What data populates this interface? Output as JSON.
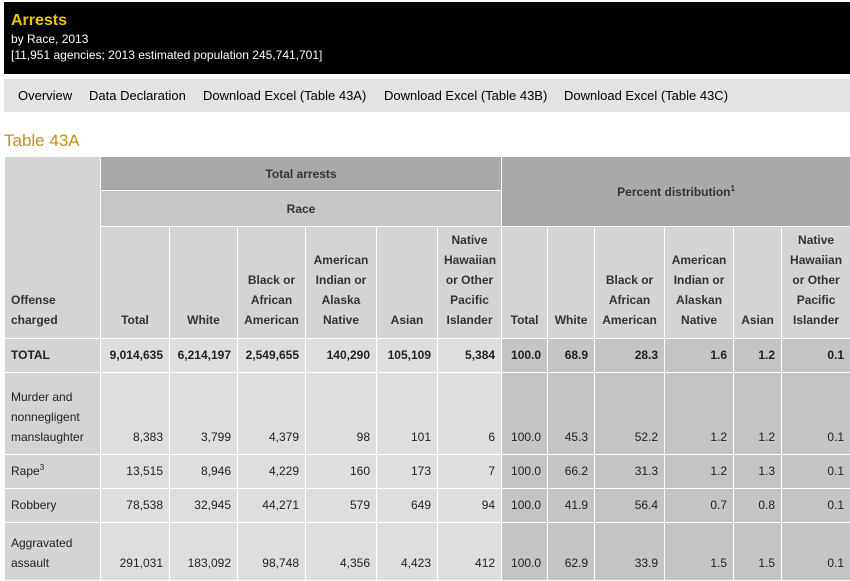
{
  "header": {
    "title": "Arrests",
    "subtitle": "by Race, 2013",
    "scope": "[11,951 agencies; 2013 estimated population 245,741,701]"
  },
  "nav": [
    {
      "label": "Overview"
    },
    {
      "label": "Data Declaration"
    },
    {
      "label": "Download Excel (Table 43A)"
    },
    {
      "label": "Download Excel (Table 43B)"
    },
    {
      "label": "Download Excel (Table 43C)"
    }
  ],
  "table_title": "Table 43A",
  "table": {
    "group_total": "Total arrests",
    "group_race": "Race",
    "group_percent": "Percent distribution",
    "group_percent_note": "1",
    "offense_header": "Offense charged",
    "count_columns": [
      "Total",
      "White",
      "Black or African American",
      "American Indian or Alaska Native",
      "Asian",
      "Native Hawaiian or Other Pacific Islander"
    ],
    "percent_columns": [
      "Total",
      "White",
      "Black or African American",
      "American Indian or Alaskan Native",
      "Asian",
      "Native Hawaiian or Other Pacific Islander"
    ],
    "rows": [
      {
        "offense": "TOTAL",
        "note": "",
        "counts": [
          "9,014,635",
          "6,214,197",
          "2,549,655",
          "140,290",
          "105,109",
          "5,384"
        ],
        "percents": [
          "100.0",
          "68.9",
          "28.3",
          "1.6",
          "1.2",
          "0.1"
        ]
      },
      {
        "offense": "Murder and nonnegligent manslaughter",
        "note": "",
        "counts": [
          "8,383",
          "3,799",
          "4,379",
          "98",
          "101",
          "6"
        ],
        "percents": [
          "100.0",
          "45.3",
          "52.2",
          "1.2",
          "1.2",
          "0.1"
        ]
      },
      {
        "offense": "Rape",
        "note": "3",
        "counts": [
          "13,515",
          "8,946",
          "4,229",
          "160",
          "173",
          "7"
        ],
        "percents": [
          "100.0",
          "66.2",
          "31.3",
          "1.2",
          "1.3",
          "0.1"
        ]
      },
      {
        "offense": "Robbery",
        "note": "",
        "counts": [
          "78,538",
          "32,945",
          "44,271",
          "579",
          "649",
          "94"
        ],
        "percents": [
          "100.0",
          "41.9",
          "56.4",
          "0.7",
          "0.8",
          "0.1"
        ]
      },
      {
        "offense": "Aggravated assault",
        "note": "",
        "counts": [
          "291,031",
          "183,092",
          "98,748",
          "4,356",
          "4,423",
          "412"
        ],
        "percents": [
          "100.0",
          "62.9",
          "33.9",
          "1.5",
          "1.5",
          "0.1"
        ]
      }
    ]
  }
}
